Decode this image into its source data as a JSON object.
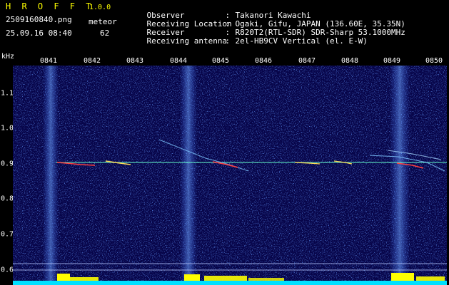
{
  "header": {
    "app_title": "H R O F F T",
    "app_version": "1.0.0",
    "filename": "2509160840.png",
    "datetime": "25.09.16 08:40",
    "meteor_label": "meteor",
    "meteor_count": "62",
    "info": [
      {
        "label": "Observer",
        "sep": ":",
        "value": "Takanori Kawachi"
      },
      {
        "label": "Receiving Location",
        "sep": ":",
        "value": "Ogaki, Gifu, JAPAN (136.60E, 35.35N)"
      },
      {
        "label": "Receiver",
        "sep": ":",
        "value": "R820T2(RTL-SDR) SDR-Sharp 53.1000MHz"
      },
      {
        "label": "Receiving antenna",
        "sep": ":",
        "value": "2el-HB9CV Vertical (el. E-W)"
      }
    ]
  },
  "axis": {
    "unit": "kHz",
    "time_ticks": [
      "0841",
      "0842",
      "0843",
      "0844",
      "0845",
      "0846",
      "0847",
      "0848",
      "0849",
      "0850"
    ],
    "freq_ticks": [
      "1.1",
      "1.0",
      "0.9",
      "0.8",
      "0.7",
      "0.6"
    ]
  },
  "colors": {
    "background": "#07054a",
    "noise": "#1a3ec8",
    "title": "#ffff00",
    "carrier": "#66ffcc",
    "meteor_hot": "#ff3333",
    "bottom_yellow": "#ffff00",
    "bottom_cyan": "#00e0ff"
  }
}
